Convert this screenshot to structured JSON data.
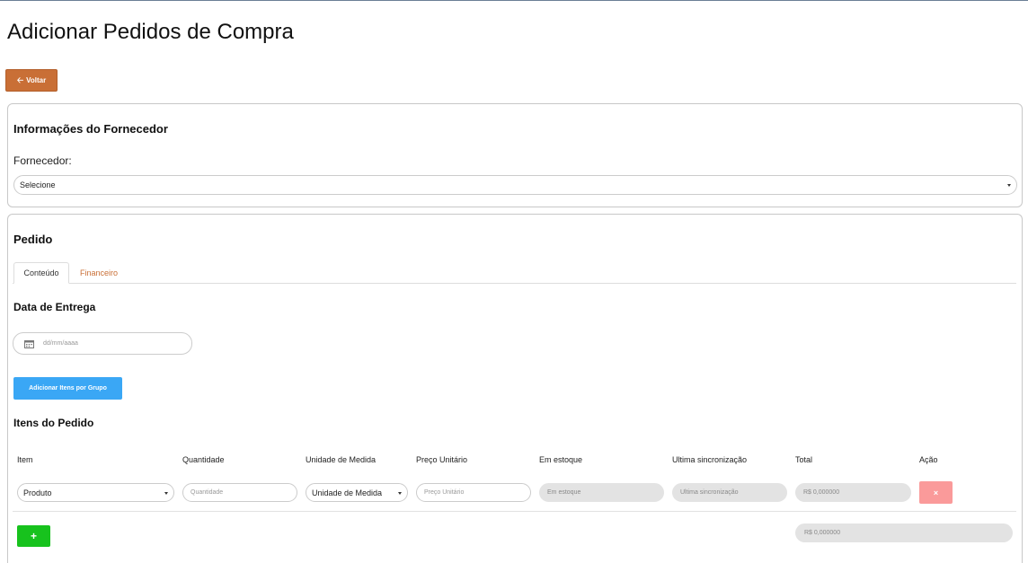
{
  "page": {
    "title": "Adicionar Pedidos de Compra"
  },
  "back_button": {
    "label": "Voltar",
    "icon": "arrow-left-icon"
  },
  "supplier": {
    "section_title": "Informações do Fornecedor",
    "field_label": "Fornecedor:",
    "selected": "Selecione"
  },
  "order": {
    "section_title": "Pedido",
    "tabs": [
      {
        "label": "Conteúdo",
        "active": true
      },
      {
        "label": "Financeiro",
        "active": false
      }
    ],
    "delivery": {
      "title": "Data de Entrega",
      "placeholder": "dd/mm/aaaa",
      "icon": "calendar-icon"
    },
    "add_by_group_label": "Adicionar Itens por Grupo",
    "items_title": "Itens do Pedido",
    "columns": [
      "Item",
      "Quantidade",
      "Unidade de Medida",
      "Preço Unitário",
      "Em estoque",
      "Ultima sincronização",
      "Total",
      "Ação"
    ],
    "row": {
      "item_selected": "Produto",
      "quantity_placeholder": "Quantidade",
      "unit_selected": "Unidade de Medida",
      "unit_price_placeholder": "Preço Unitário",
      "stock_placeholder": "Em estoque",
      "last_sync_placeholder": "Ultima sincronização",
      "total_value": "R$ 0,000000",
      "remove_label": "×"
    },
    "add_row_label": "+",
    "grand_total": "R$ 0,000000"
  },
  "colors": {
    "back_button": "#c96f36",
    "group_button": "#3aa7f5",
    "add_button": "#17c21d",
    "remove_button": "#fa9a9a",
    "inactive_tab_text": "#c96f36"
  }
}
